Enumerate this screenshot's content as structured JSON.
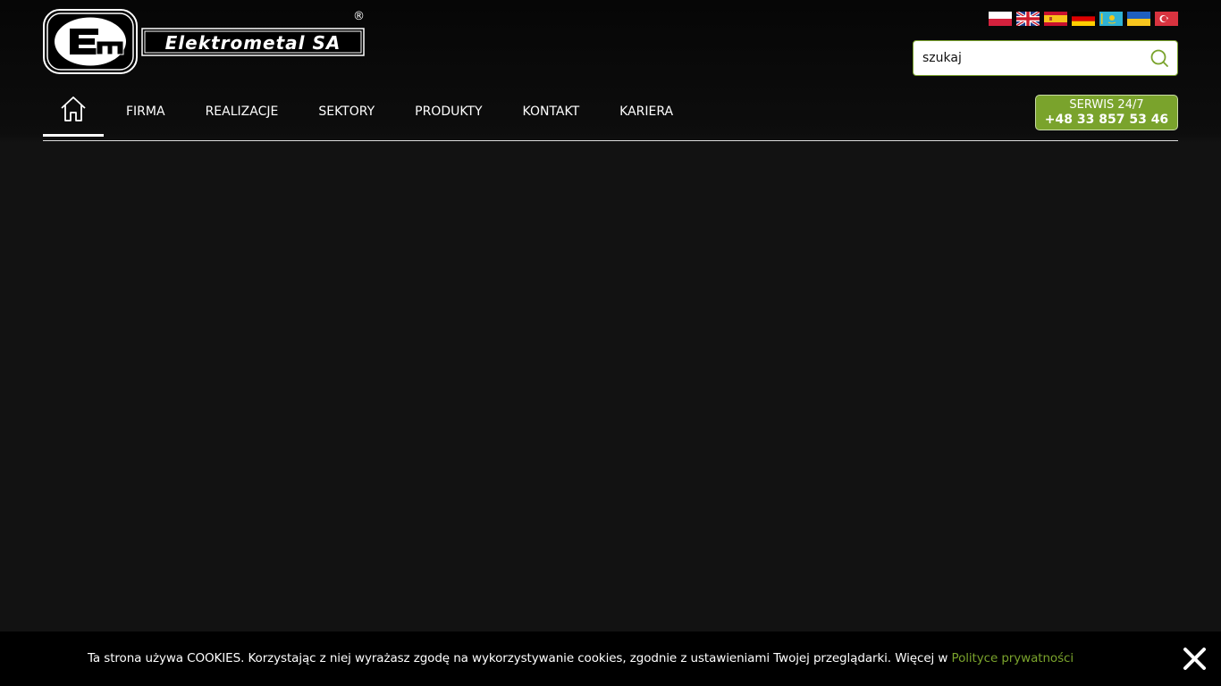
{
  "header": {
    "logo_text": "Elektrometal SA",
    "logo_mark": "registered-trademark",
    "logo_reg_symbol": "®"
  },
  "languages": [
    {
      "code": "pl",
      "icon": "flag-poland-icon"
    },
    {
      "code": "en",
      "icon": "flag-uk-icon"
    },
    {
      "code": "es",
      "icon": "flag-spain-icon"
    },
    {
      "code": "de",
      "icon": "flag-germany-icon"
    },
    {
      "code": "kz",
      "icon": "flag-kazakhstan-icon"
    },
    {
      "code": "ua",
      "icon": "flag-ukraine-icon"
    },
    {
      "code": "tr",
      "icon": "flag-turkey-icon"
    }
  ],
  "search": {
    "placeholder": "szukaj",
    "icon": "search-icon"
  },
  "nav": {
    "home_icon": "home-icon",
    "items": [
      {
        "label": "FIRMA"
      },
      {
        "label": "REALIZACJE"
      },
      {
        "label": "SEKTORY"
      },
      {
        "label": "PRODUKTY"
      },
      {
        "label": "KONTAKT"
      },
      {
        "label": "KARIERA"
      }
    ]
  },
  "service": {
    "label": "SERWIS 24/7",
    "phone": "+48 33 857 53 46"
  },
  "cookie": {
    "text": "Ta strona używa COOKIES. Korzystając z niej wyrażasz zgodę na wykorzystywanie cookies, zgodnie z ustawieniami Twojej przeglądarki. Więcej w ",
    "link_text": "Polityce prywatności",
    "close_icon": "close-icon"
  },
  "colors": {
    "accent": "#7aa32c",
    "background": "#121212",
    "header_background": "#060606",
    "cookie_background": "#000000"
  }
}
